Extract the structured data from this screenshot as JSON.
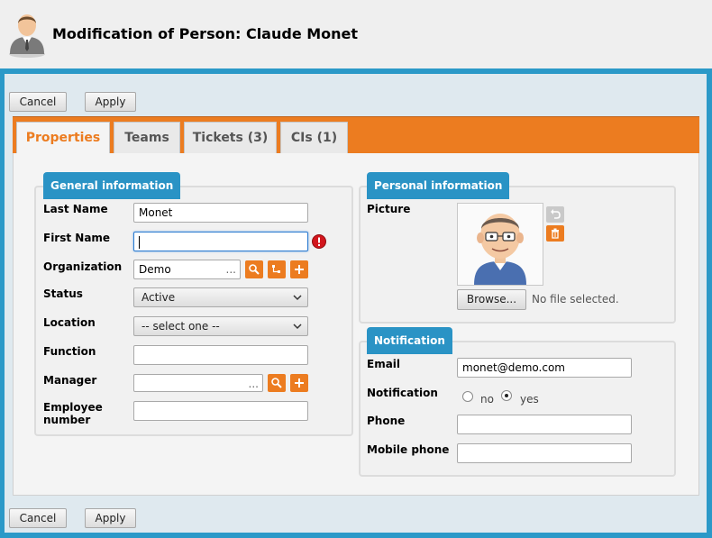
{
  "header": {
    "title": "Modification of Person: Claude Monet",
    "icon": "person-icon"
  },
  "toolbar": {
    "cancel_label": "Cancel",
    "apply_label": "Apply"
  },
  "tabs": [
    {
      "label": "Properties",
      "active": true
    },
    {
      "label": "Teams",
      "active": false
    },
    {
      "label": "Tickets (3)",
      "active": false
    },
    {
      "label": "CIs (1)",
      "active": false
    }
  ],
  "general": {
    "legend": "General information",
    "last_name": {
      "label": "Last Name",
      "value": "Monet"
    },
    "first_name": {
      "label": "First Name",
      "value": "",
      "error": true
    },
    "organization": {
      "label": "Organization",
      "value": "Demo",
      "ellipsis": "..."
    },
    "status": {
      "label": "Status",
      "value": "Active"
    },
    "location": {
      "label": "Location",
      "value": "-- select one --"
    },
    "function": {
      "label": "Function",
      "value": ""
    },
    "manager": {
      "label": "Manager",
      "value": "",
      "ellipsis": "..."
    },
    "employee_number": {
      "label_line1": "Employee",
      "label_line2": "number",
      "value": ""
    }
  },
  "personal": {
    "legend": "Personal information",
    "picture_label": "Picture",
    "browse_label": "Browse...",
    "no_file": "No file selected."
  },
  "notification": {
    "legend": "Notification",
    "email": {
      "label": "Email",
      "value": "monet@demo.com"
    },
    "notification": {
      "label": "Notification",
      "options": [
        "no",
        "yes"
      ],
      "selected": "yes"
    },
    "phone": {
      "label": "Phone",
      "value": ""
    },
    "mobile_phone": {
      "label": "Mobile phone",
      "value": ""
    }
  },
  "colors": {
    "accent_orange": "#ec7c20",
    "accent_blue": "#2a93c5",
    "error_red": "#d2161d"
  }
}
